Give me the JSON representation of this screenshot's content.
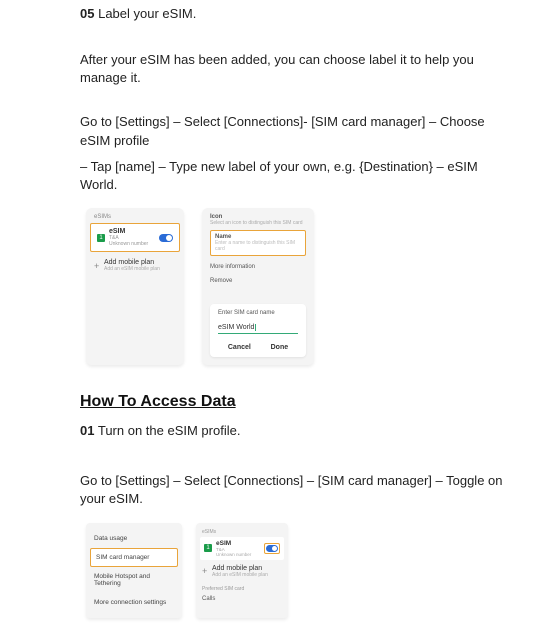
{
  "step05": {
    "num": "05",
    "text": "Label your eSIM."
  },
  "p_after": "After your eSIM has been added, you can choose label it to help you manage it.",
  "p_goto1": "Go to [Settings] – Select [Connections]- [SIM card manager] – Choose eSIM profile",
  "p_tap": "– Tap [name] – Type new label of your own, e.g. {Destination} – eSIM World.",
  "mock_a": {
    "section": "eSIMs",
    "badge": "1",
    "title": "eSIM",
    "sub1": "T&A",
    "sub2": "Unknown number",
    "add_title": "Add mobile plan",
    "add_sub": "Add an eSIM mobile plan"
  },
  "mock_b": {
    "icon_h": "Icon",
    "icon_s": "Select an icon to distinguish this SIM card",
    "name_h": "Name",
    "name_s": "Enter a name to distinguish this SIM card",
    "more": "More information",
    "remove": "Remove",
    "entry_cap": "Enter SIM card name",
    "entry_val_a": "eSIM ",
    "entry_val_b": "World",
    "cancel": "Cancel",
    "done": "Done"
  },
  "heading_access": "How To Access Data",
  "step01": {
    "num": "01",
    "text": "Turn on the eSIM profile."
  },
  "p_goto2": "Go to [Settings] – Select [Connections] – [SIM card manager] – Toggle on your eSIM.",
  "mock_c": {
    "r1": "Data usage",
    "r2": "SIM card manager",
    "r3": "Mobile Hotspot and Tethering",
    "r4": "More connection settings"
  },
  "mock_d": {
    "section": "eSIMs",
    "badge": "1",
    "title": "eSIM",
    "sub1": "T&A",
    "sub2": "Unknown number",
    "add_title": "Add mobile plan",
    "add_sub": "Add an eSIM mobile plan",
    "pref": "Preferred SIM card",
    "calls": "Calls"
  }
}
